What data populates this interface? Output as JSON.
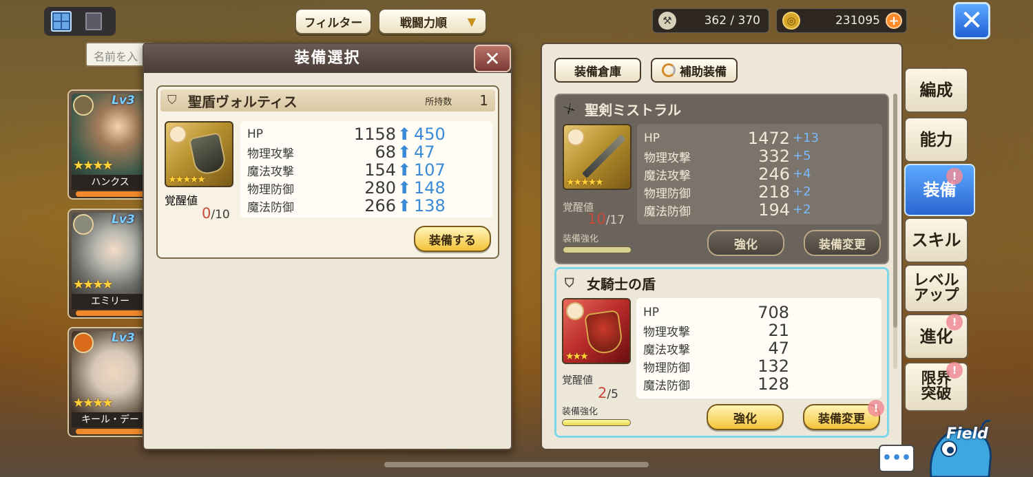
{
  "topbar": {
    "filter_label": "フィルター",
    "sort_label": "戦闘力順",
    "stamina": "362 / 370",
    "gold": "231095",
    "plus_glyph": "+",
    "close_glyph": "✕"
  },
  "search": {
    "placeholder": "名前を入"
  },
  "characters": [
    {
      "name": "ハンクス",
      "level": "Lv3",
      "stars": "★★★★",
      "crest_color": "#7a6a48"
    },
    {
      "name": "エミリー",
      "level": "Lv3",
      "stars": "★★★★",
      "crest_color": "#8a8a7a"
    },
    {
      "name": "キール・デー",
      "level": "Lv3",
      "stars": "★★★★",
      "crest_color": "#d86a1a"
    }
  ],
  "modal": {
    "title": "装備選択",
    "close_glyph": "✕",
    "item": {
      "name": "聖盾ヴォルティス",
      "owned_label": "所持数",
      "owned_count": "1",
      "stars": "★★★★★",
      "awaken_label": "覚醒値",
      "awaken_current": "0",
      "awaken_max": "/10",
      "stats": [
        {
          "name": "HP",
          "value": "1158",
          "increase": "450"
        },
        {
          "name": "物理攻撃",
          "value": "68",
          "increase": "47"
        },
        {
          "name": "魔法攻撃",
          "value": "154",
          "increase": "107"
        },
        {
          "name": "物理防御",
          "value": "280",
          "increase": "148"
        },
        {
          "name": "魔法防御",
          "value": "266",
          "increase": "138"
        }
      ],
      "up_glyph": "⬆",
      "equip_button": "装備する"
    }
  },
  "right_panel": {
    "warehouse_tab": "装備倉庫",
    "assist_tab": "補助装備",
    "slots": [
      {
        "name": "聖剣ミストラル",
        "stars": "★★★★★",
        "awaken_label": "覚醒値",
        "awaken_current": "10",
        "awaken_max": "/17",
        "enhance_label": "装備強化",
        "enhance_progress": 0.0,
        "stats": [
          {
            "name": "HP",
            "value": "1472",
            "bonus": "+13"
          },
          {
            "name": "物理攻撃",
            "value": "332",
            "bonus": "+5"
          },
          {
            "name": "魔法攻撃",
            "value": "246",
            "bonus": "+4"
          },
          {
            "name": "物理防御",
            "value": "218",
            "bonus": "+2"
          },
          {
            "name": "魔法防御",
            "value": "194",
            "bonus": "+2"
          }
        ],
        "strengthen_button": "強化",
        "change_button": "装備変更"
      },
      {
        "name": "女騎士の盾",
        "stars": "★★★",
        "awaken_label": "覚醒値",
        "awaken_current": "2",
        "awaken_max": "/5",
        "enhance_label": "装備強化",
        "enhance_progress": 0.0,
        "stats": [
          {
            "name": "HP",
            "value": "708"
          },
          {
            "name": "物理攻撃",
            "value": "21"
          },
          {
            "name": "魔法攻撃",
            "value": "47"
          },
          {
            "name": "物理防御",
            "value": "132"
          },
          {
            "name": "魔法防御",
            "value": "128"
          }
        ],
        "strengthen_button": "強化",
        "change_button": "装備変更",
        "badge": "!"
      }
    ]
  },
  "side_tabs": [
    {
      "label": "編成"
    },
    {
      "label": "能力"
    },
    {
      "label": "装備",
      "active": true,
      "badge": "!"
    },
    {
      "label": "スキル"
    },
    {
      "label": "レベル\nアップ"
    },
    {
      "label": "進化",
      "badge": "!"
    },
    {
      "label": "限界\n突破",
      "badge": "!"
    }
  ],
  "field_button": "Field",
  "chat_glyph": "•••",
  "colors": {
    "accent_blue": "#2a66d0",
    "stat_up_blue": "#3a8ad8",
    "gold_button": "#f4c43a",
    "awaken_red": "#c84a3a"
  }
}
